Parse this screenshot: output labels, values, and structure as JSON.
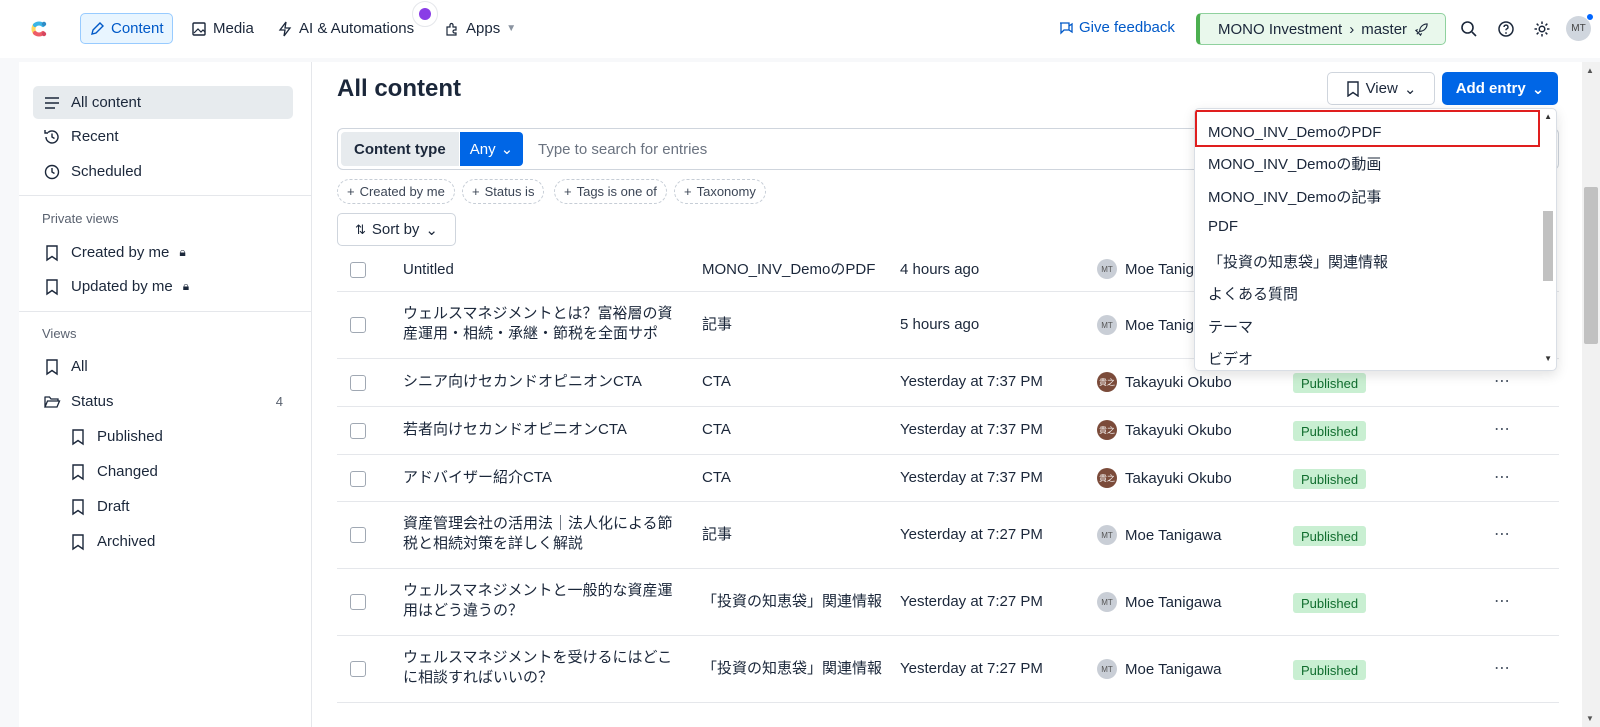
{
  "topbar": {
    "nav": [
      "Content",
      "Media",
      "AI & Automations",
      "Apps"
    ],
    "feedback": "Give feedback",
    "space": "MONO Investment",
    "environment": "master",
    "avatar_initials": "MT"
  },
  "sidebar": {
    "all_content": "All content",
    "recent": "Recent",
    "scheduled": "Scheduled",
    "private_views_heading": "Private views",
    "private_views": [
      "Created by me",
      "Updated by me"
    ],
    "views_heading": "Views",
    "all": "All",
    "status": "Status",
    "status_count": "4",
    "status_items": [
      "Published",
      "Changed",
      "Draft",
      "Archived"
    ]
  },
  "main": {
    "title": "All content",
    "view_button": "View",
    "add_entry_button": "Add entry",
    "content_type_label": "Content type",
    "content_type_value": "Any",
    "search_placeholder": "Type to search for entries",
    "filter_chips": [
      "Created by me",
      "Status is",
      "Tags is one of",
      "Taxonomy"
    ],
    "sort_by": "Sort by"
  },
  "entries": [
    {
      "title": "Untitled",
      "content_type": "MONO_INV_DemoのPDF",
      "updated": "4 hours ago",
      "author": "Moe Tanig",
      "author_initials": "MT",
      "status": ""
    },
    {
      "title": "ウェルスマネジメントとは？富裕層の資産運用・相続・承継・節税を全面サポー…",
      "content_type": "記事",
      "updated": "5 hours ago",
      "author": "Moe Tanig",
      "author_initials": "MT",
      "status": ""
    },
    {
      "title": "シニア向けセカンドオピニオンCTA",
      "content_type": "CTA",
      "updated": "Yesterday at 7:37 PM",
      "author": "Takayuki Okubo",
      "author_initials": "貴之",
      "status": "Published"
    },
    {
      "title": "若者向けセカンドオピニオンCTA",
      "content_type": "CTA",
      "updated": "Yesterday at 7:37 PM",
      "author": "Takayuki Okubo",
      "author_initials": "貴之",
      "status": "Published"
    },
    {
      "title": "アドバイザー紹介CTA",
      "content_type": "CTA",
      "updated": "Yesterday at 7:37 PM",
      "author": "Takayuki Okubo",
      "author_initials": "貴之",
      "status": "Published"
    },
    {
      "title": "資産管理会社の活用法｜法人化による節税と相続対策を詳しく解説",
      "content_type": "記事",
      "updated": "Yesterday at 7:27 PM",
      "author": "Moe Tanigawa",
      "author_initials": "MT",
      "status": "Published"
    },
    {
      "title": "ウェルスマネジメントと一般的な資産運用はどう違うの？",
      "content_type": "「投資の知恵袋」関連情報",
      "updated": "Yesterday at 7:27 PM",
      "author": "Moe Tanigawa",
      "author_initials": "MT",
      "status": "Published"
    },
    {
      "title": "ウェルスマネジメントを受けるにはどこに相談すればいいの？",
      "content_type": "「投資の知恵袋」関連情報",
      "updated": "Yesterday at 7:27 PM",
      "author": "Moe Tanigawa",
      "author_initials": "MT",
      "status": "Published"
    }
  ],
  "dropdown": {
    "items": [
      "MONO_INV_DemoのPDF",
      "MONO_INV_Demoの動画",
      "MONO_INV_Demoの記事",
      "PDF",
      "「投資の知恵袋」関連情報",
      "よくある質問",
      "テーマ",
      "ビデオ"
    ]
  },
  "colors": {
    "accent": "#0066e6",
    "highlight_border": "#e01e1e",
    "published_bg": "#c9efd2"
  }
}
